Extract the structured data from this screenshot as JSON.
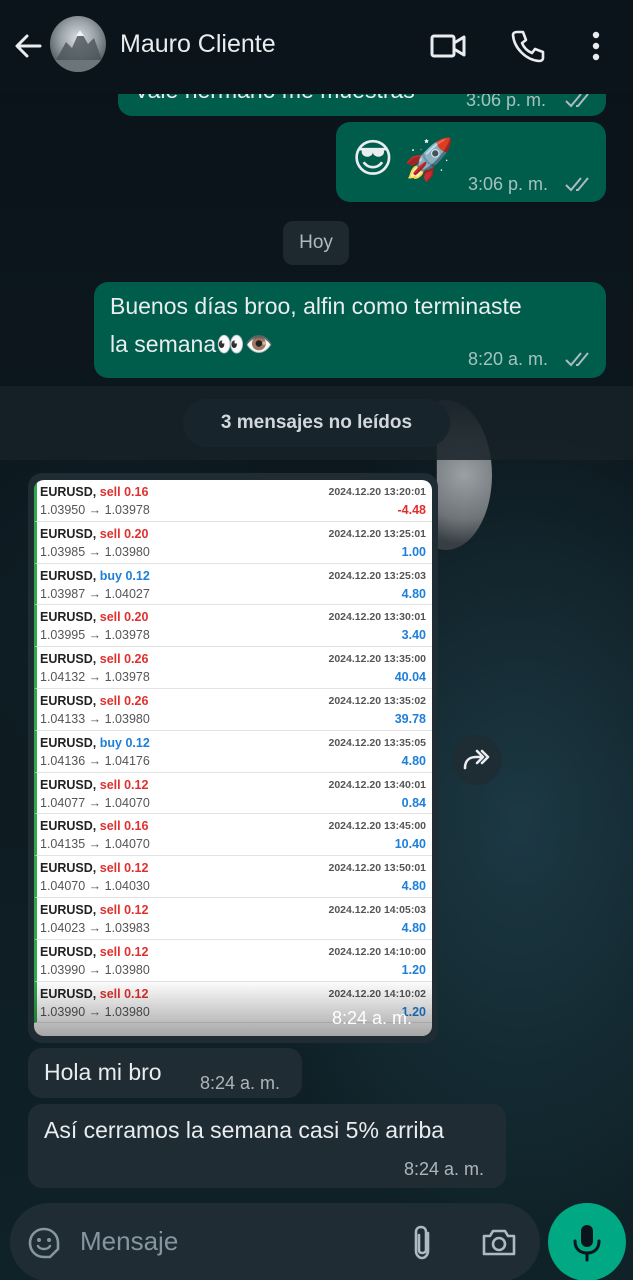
{
  "header": {
    "contact_name": "Mauro Cliente",
    "icons": [
      "back-arrow-icon",
      "video-call-icon",
      "phone-call-icon",
      "more-vert-icon"
    ]
  },
  "messages": {
    "m0": {
      "text": "Vale hermano me muestras",
      "time": "3:06 p. m."
    },
    "m1": {
      "emoji_1": "😎",
      "emoji_2": "🚀",
      "time": "3:06 p. m."
    },
    "date_chip": "Hoy",
    "m2": {
      "line1": "Buenos días broo, alfin como terminaste",
      "line2": "la semana👀👁️",
      "time": "8:20 a. m."
    },
    "unread": "3 mensajes no leídos",
    "image": {
      "time": "8:24 a. m.",
      "trades": [
        {
          "symbol": "EURUSD,",
          "type": "sell",
          "lot": "0.16",
          "prices": "1.03950 → 1.03978",
          "date": "2024.12.20 13:20:01",
          "profit": "-4.48"
        },
        {
          "symbol": "EURUSD,",
          "type": "sell",
          "lot": "0.20",
          "prices": "1.03985 → 1.03980",
          "date": "2024.12.20 13:25:01",
          "profit": "1.00"
        },
        {
          "symbol": "EURUSD,",
          "type": "buy",
          "lot": "0.12",
          "prices": "1.03987 → 1.04027",
          "date": "2024.12.20 13:25:03",
          "profit": "4.80"
        },
        {
          "symbol": "EURUSD,",
          "type": "sell",
          "lot": "0.20",
          "prices": "1.03995 → 1.03978",
          "date": "2024.12.20 13:30:01",
          "profit": "3.40"
        },
        {
          "symbol": "EURUSD,",
          "type": "sell",
          "lot": "0.26",
          "prices": "1.04132 → 1.03978",
          "date": "2024.12.20 13:35:00",
          "profit": "40.04"
        },
        {
          "symbol": "EURUSD,",
          "type": "sell",
          "lot": "0.26",
          "prices": "1.04133 → 1.03980",
          "date": "2024.12.20 13:35:02",
          "profit": "39.78"
        },
        {
          "symbol": "EURUSD,",
          "type": "buy",
          "lot": "0.12",
          "prices": "1.04136 → 1.04176",
          "date": "2024.12.20 13:35:05",
          "profit": "4.80"
        },
        {
          "symbol": "EURUSD,",
          "type": "sell",
          "lot": "0.12",
          "prices": "1.04077 → 1.04070",
          "date": "2024.12.20 13:40:01",
          "profit": "0.84"
        },
        {
          "symbol": "EURUSD,",
          "type": "sell",
          "lot": "0.16",
          "prices": "1.04135 → 1.04070",
          "date": "2024.12.20 13:45:00",
          "profit": "10.40"
        },
        {
          "symbol": "EURUSD,",
          "type": "sell",
          "lot": "0.12",
          "prices": "1.04070 → 1.04030",
          "date": "2024.12.20 13:50:01",
          "profit": "4.80"
        },
        {
          "symbol": "EURUSD,",
          "type": "sell",
          "lot": "0.12",
          "prices": "1.04023 → 1.03983",
          "date": "2024.12.20 14:05:03",
          "profit": "4.80"
        },
        {
          "symbol": "EURUSD,",
          "type": "sell",
          "lot": "0.12",
          "prices": "1.03990 → 1.03980",
          "date": "2024.12.20 14:10:00",
          "profit": "1.20"
        },
        {
          "symbol": "EURUSD,",
          "type": "sell",
          "lot": "0.12",
          "prices": "1.03990 → 1.03980",
          "date": "2024.12.20 14:10:02",
          "profit": "1.20"
        }
      ]
    },
    "m3": {
      "text": "Hola mi bro",
      "time": "8:24 a. m."
    },
    "m4": {
      "text": "Así cerramos la semana casi 5% arriba",
      "time": "8:24 a. m."
    }
  },
  "composer": {
    "placeholder": "Mensaje",
    "icons": [
      "emoji-sticker-icon",
      "attach-icon",
      "camera-icon",
      "mic-icon"
    ]
  },
  "colors": {
    "outgoing_bubble": "#005c4b",
    "incoming_bubble": "#202c33",
    "accent": "#00a884",
    "sell": "#e0302e",
    "buy": "#1e7fd8"
  }
}
